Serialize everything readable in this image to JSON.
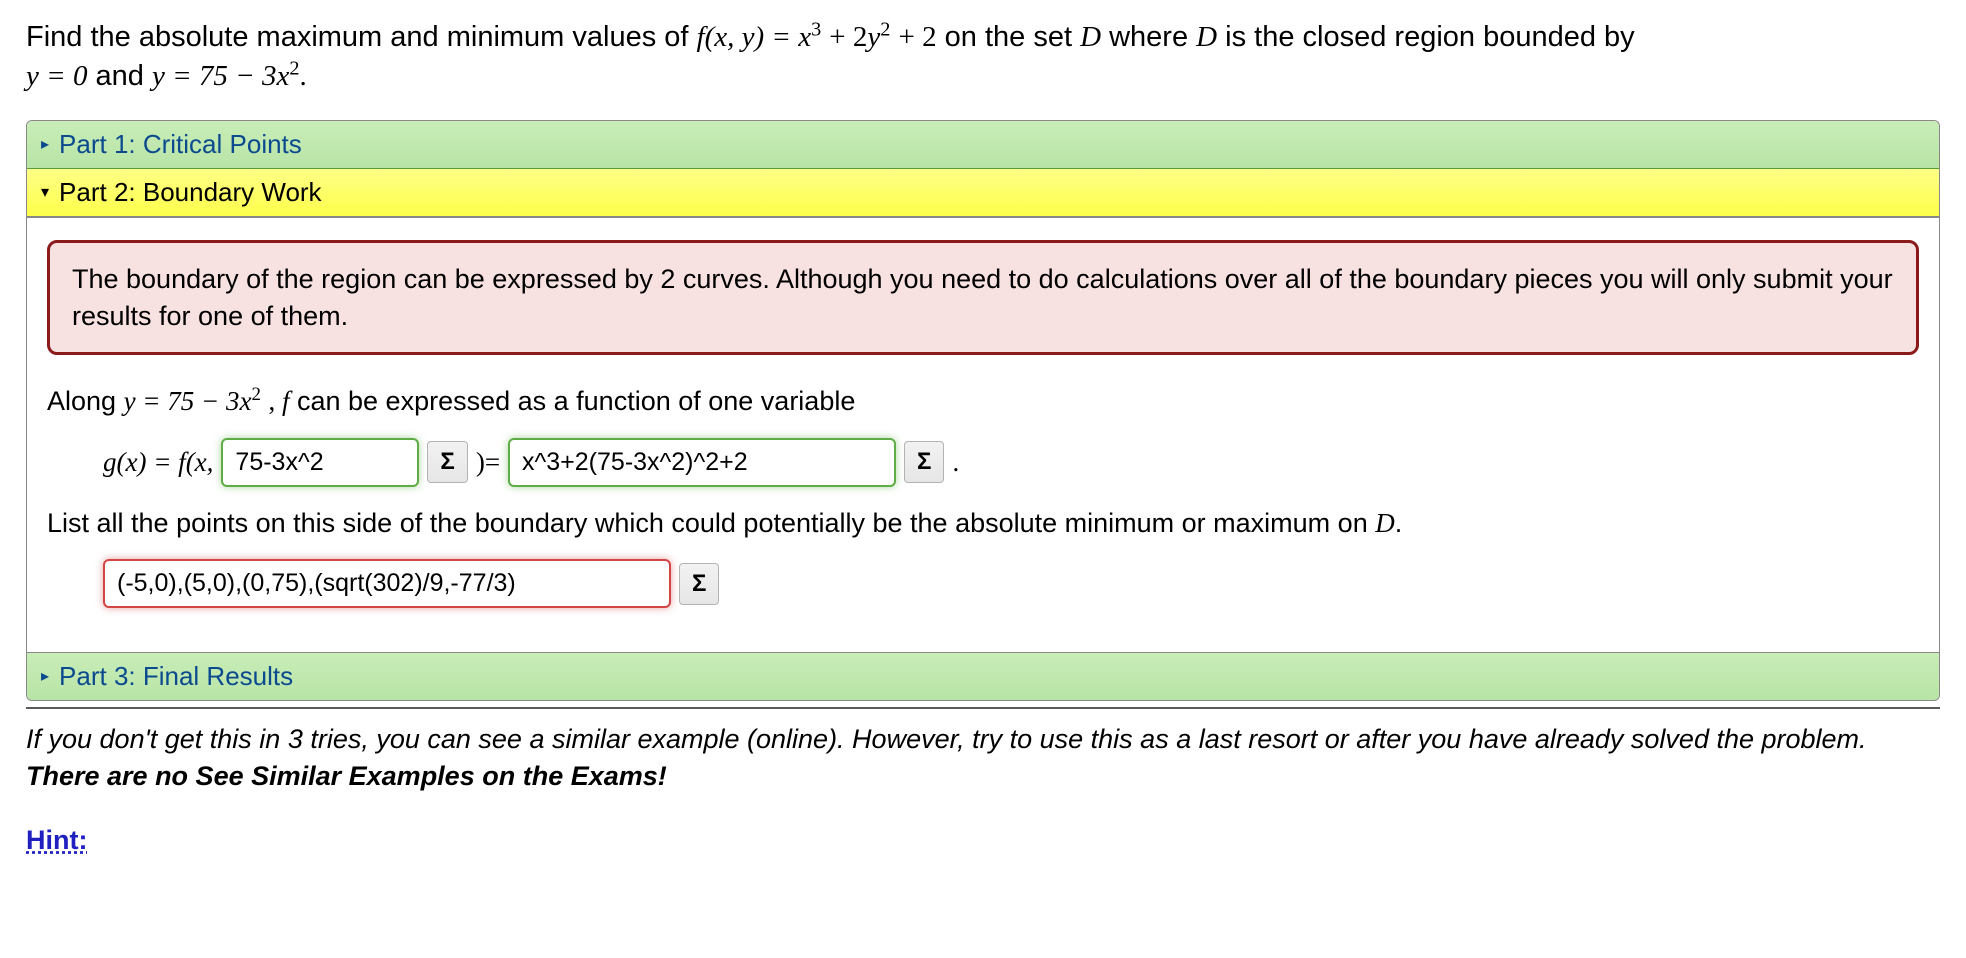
{
  "prompt": {
    "line1_pre": "Find the absolute maximum and minimum values of ",
    "func_def_lhs": "f(x, y) = ",
    "func_def_rhs_t1": "x",
    "func_def_rhs_e1": "3",
    "func_def_rhs_plus1": " + 2",
    "func_def_rhs_t2": "y",
    "func_def_rhs_e2": "2",
    "func_def_rhs_tail": " + 2",
    "line1_mid": " on the set ",
    "setD": "D",
    "line1_post": " where ",
    "line1_end": " is the closed region bounded by",
    "line2_a": "y = 0",
    "line2_and": " and ",
    "line2_b_lhs": "y = 75 − 3",
    "line2_b_x": "x",
    "line2_b_exp": "2",
    "line2_period": "."
  },
  "parts": {
    "p1": {
      "label": "Part 1: Critical Points",
      "arrow": "▸"
    },
    "p2": {
      "label": "Part 2: Boundary Work",
      "arrow": "▾"
    },
    "p3": {
      "label": "Part 3: Final Results",
      "arrow": "▸"
    }
  },
  "alert": "The boundary of the region can be expressed by 2 curves. Although you need to do calculations over all of the boundary pieces you will only submit your results for one of them.",
  "body": {
    "along_pre": "Along ",
    "along_eq_lhs": "y = 75 − 3",
    "along_eq_x": "x",
    "along_eq_exp": "2",
    "along_mid": " , ",
    "along_f": "f",
    "along_post": " can be expressed as a function of one variable",
    "gx_lhs": "g(x) = f(x, ",
    "input1_value": "75-3x^2",
    "close_paren_eq": " )= ",
    "input2_value": "x^3+2(75-3x^2)^2+2",
    "period": " .",
    "list_text_pre": "List all the points on this side of the boundary which could potentially be the absolute minimum or maximum on ",
    "list_text_D": "D",
    "list_text_post": ".",
    "input3_value": "(-5,0),(5,0),(0,75),(sqrt(302)/9,-77/3)"
  },
  "sigma": "Σ",
  "footer": {
    "italic": "If you don't get this in 3 tries, you can see a similar example (online). However, try to use this as a last resort or after you have already solved the problem. ",
    "bold": "There are no See Similar Examples on the Exams!"
  },
  "hint_label": "Hint:"
}
